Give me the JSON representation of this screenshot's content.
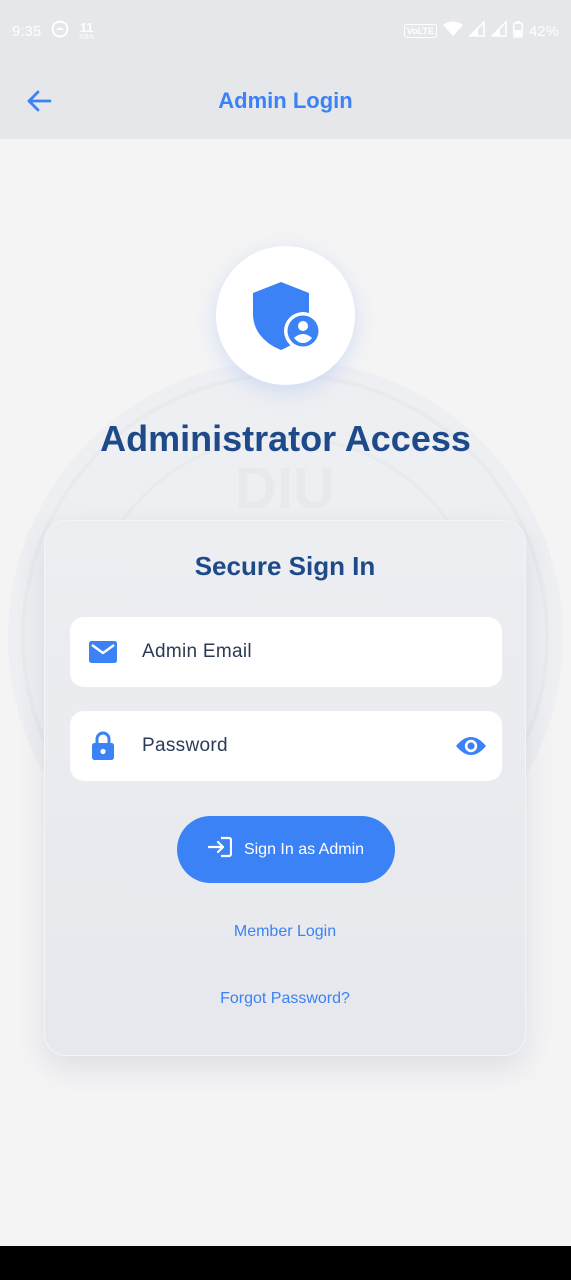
{
  "status_bar": {
    "time": "9:35",
    "net_speed": "11",
    "net_unit": "KB/s",
    "volte": "VoLTE",
    "battery": "42%",
    "icons": [
      "notification-icon",
      "wifi-icon",
      "signal-icon",
      "signal-icon",
      "battery-icon"
    ]
  },
  "app_bar": {
    "title": "Admin Login",
    "back_icon": "arrow-left-icon"
  },
  "hero": {
    "icon": "admin-shield-icon",
    "heading": "Administrator Access"
  },
  "card": {
    "title": "Secure Sign In",
    "email_field": {
      "placeholder": "Admin Email",
      "icon": "mail-icon"
    },
    "password_field": {
      "placeholder": "Password",
      "icon": "lock-icon",
      "toggle_icon": "eye-icon"
    },
    "sign_in_button": {
      "label": "Sign In as Admin",
      "icon": "login-icon"
    },
    "member_login_link": "Member Login",
    "forgot_password_link": "Forgot Password?"
  },
  "colors": {
    "primary": "#3b82f6",
    "heading": "#1e4a8a",
    "background": "#f4f4f5",
    "appbar": "#e6e7eb"
  }
}
